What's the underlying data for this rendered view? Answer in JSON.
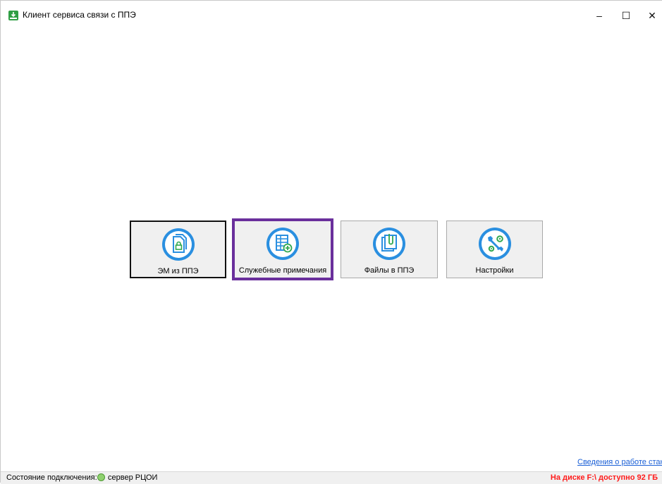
{
  "window": {
    "title": "Клиент сервиса связи с ППЭ",
    "controls": {
      "minimize": "–",
      "maximize": "☐",
      "close": "✕"
    },
    "icon": "app-download-icon"
  },
  "tiles": [
    {
      "label": "ЭМ из ППЭ",
      "icon": "document-lock-icon",
      "selected": false
    },
    {
      "label": "Служебные примечания",
      "icon": "table-add-icon",
      "selected": true
    },
    {
      "label": "Файлы в ППЭ",
      "icon": "files-clip-icon",
      "selected": false
    },
    {
      "label": "Настройки",
      "icon": "wrench-gears-icon",
      "selected": false
    }
  ],
  "colors": {
    "selected_border": "#6a2f9c",
    "icon_blue": "#2a8fe0",
    "icon_green": "#2fa84f",
    "disk_warning": "#ff1a1a",
    "link": "#1a5fd6"
  },
  "links": {
    "station_info": "Сведения о работе станци"
  },
  "status": {
    "connection_label": "Состояние подключения:",
    "server": "сервер РЦОИ",
    "disk": "На диске F:\\ доступно 92 ГБ"
  }
}
